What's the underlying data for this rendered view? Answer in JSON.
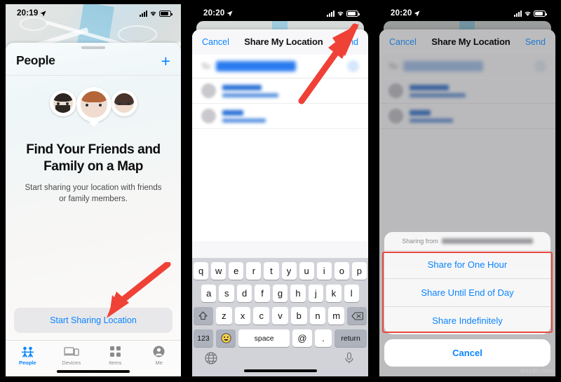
{
  "panel1": {
    "status": {
      "time": "20:19"
    },
    "sheet_title": "People",
    "add_button": "+",
    "empty_title": "Find Your Friends and Family on a Map",
    "empty_subtitle": "Start sharing your location with friends or family members.",
    "cta_label": "Start Sharing Location",
    "tabs": [
      {
        "label": "People",
        "icon": "people-icon",
        "active": true
      },
      {
        "label": "Devices",
        "icon": "devices-icon",
        "active": false
      },
      {
        "label": "Items",
        "icon": "items-icon",
        "active": false
      },
      {
        "label": "Me",
        "icon": "person-circle-icon",
        "active": false
      }
    ]
  },
  "panel2": {
    "status": {
      "time": "20:20"
    },
    "nav": {
      "cancel": "Cancel",
      "title": "Share My Location",
      "send": "Send"
    },
    "keyboard": {
      "row1": [
        "q",
        "w",
        "e",
        "r",
        "t",
        "y",
        "u",
        "i",
        "o",
        "p"
      ],
      "row2": [
        "a",
        "s",
        "d",
        "f",
        "g",
        "h",
        "j",
        "k",
        "l"
      ],
      "row3": [
        "z",
        "x",
        "c",
        "v",
        "b",
        "n",
        "m"
      ],
      "shift_icon": "shift-icon",
      "backspace_icon": "backspace-icon",
      "numbers_key": "123",
      "emoji_icon": "emoji-icon",
      "space_key": "space",
      "at_key": "@",
      "dot_key": ".",
      "return_key": "return",
      "globe_icon": "globe-icon",
      "mic_icon": "microphone-icon"
    }
  },
  "panel3": {
    "status": {
      "time": "20:20"
    },
    "nav": {
      "cancel": "Cancel",
      "title": "Share My Location",
      "send": "Send"
    },
    "action_sheet": {
      "header_prefix": "Sharing from",
      "options": [
        "Share for One Hour",
        "Share Until End of Day",
        "Share Indefinitely"
      ],
      "cancel": "Cancel"
    }
  },
  "watermark": "wsxdn.com",
  "colors": {
    "accent_blue": "#0a84ff",
    "highlight_red": "#e8493f",
    "arrow_red": "#ef4136"
  }
}
